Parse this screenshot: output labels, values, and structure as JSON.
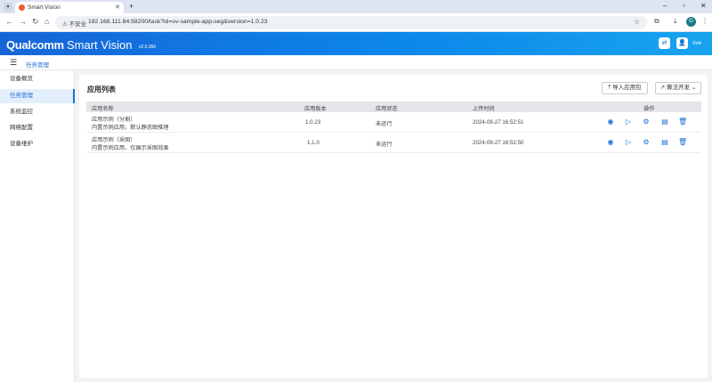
{
  "browser": {
    "tab_title": "Smart Vision",
    "url": "192.168.111.84:58200/task?id=sv-sample-app-seg&version=1.0.23",
    "security_label": "不安全",
    "profile_initial": "G"
  },
  "header": {
    "brand": "Qualcomm",
    "product": "Smart Vision",
    "version": "v2.0.366",
    "user": "sve"
  },
  "breadcrumb": {
    "current": "任务管理"
  },
  "sidebar": {
    "items": [
      {
        "label": "设备概览",
        "active": false
      },
      {
        "label": "任务管理",
        "active": true
      },
      {
        "label": "系统监控",
        "active": false
      },
      {
        "label": "网络配置",
        "active": false
      },
      {
        "label": "设备维护",
        "active": false
      }
    ]
  },
  "main": {
    "title": "应用列表",
    "import_button": "导入应用包",
    "dev_button": "算法开发",
    "columns": [
      "应用名称",
      "应用版本",
      "应用状态",
      "上传时间",
      "操作"
    ],
    "rows": [
      {
        "name": "应用示例（分割）",
        "desc": "内置示例应用，默认静态图推理",
        "version": "1.0.23",
        "status": "未运行",
        "uploaded": "2024-09-27 16:52:51"
      },
      {
        "name": "应用示例（采图）",
        "desc": "内置示例应用，仅展示采图效果",
        "version": "1.1.0",
        "status": "未运行",
        "uploaded": "2024-09-27 16:52:50"
      }
    ]
  },
  "icons": {
    "view": "eye-icon",
    "run": "play-icon",
    "settings": "gear-icon",
    "edit": "document-icon",
    "delete": "trash-icon"
  },
  "colors": {
    "accent": "#1a6fd6",
    "header_start": "#1665d8",
    "header_end": "#18a4ef"
  }
}
